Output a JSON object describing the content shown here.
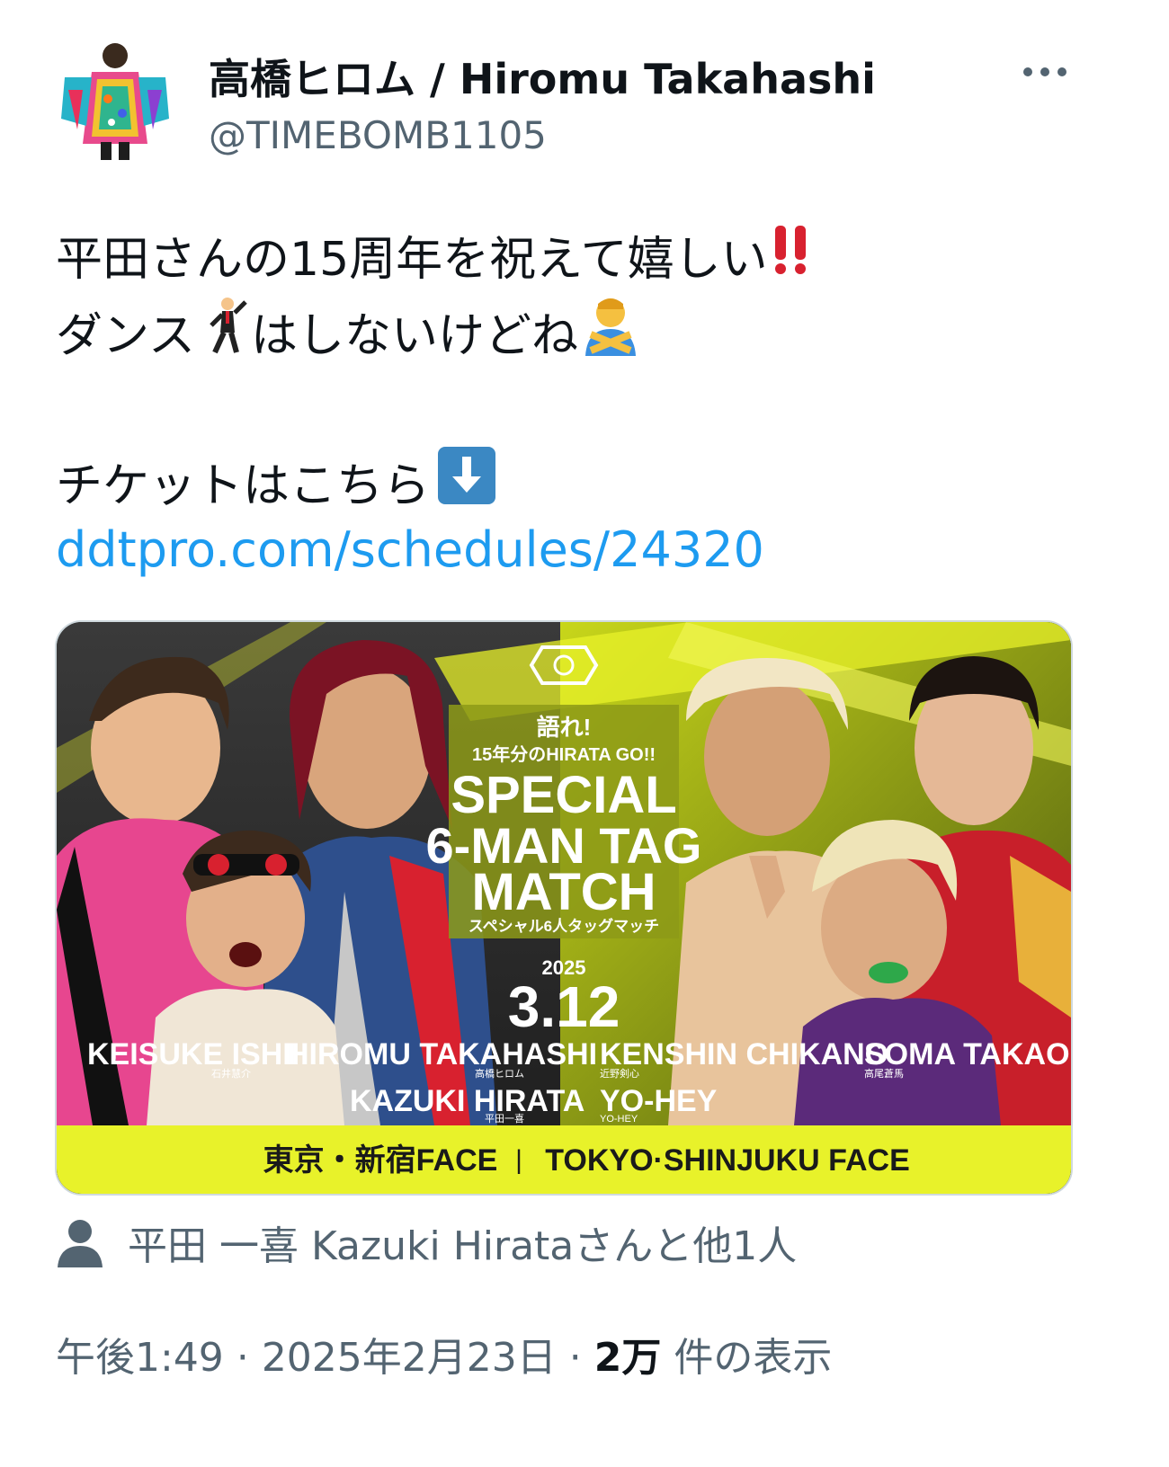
{
  "header": {
    "display_name": "高橋ヒロム / Hiromu Takahashi",
    "handle": "@TIMEBOMB1105",
    "more_icon": "more-horizontal-icon"
  },
  "body": {
    "line1": "平田さんの15周年を祝えて嬉しい",
    "line1_emoji": "double-exclamation-icon",
    "line2_a": "ダンス",
    "line2_emoji_a": "man-dancing-icon",
    "line2_b": "はしないけどね",
    "line2_emoji_b": "person-gesturing-no-icon",
    "line3": "チケットはこちら",
    "line3_emoji": "down-arrow-icon",
    "link": "ddtpro.com/schedules/24320"
  },
  "poster": {
    "header_line1": "語れ!",
    "header_line2": "15年分のHIRATA GO!!",
    "title_line1": "SPECIAL",
    "title_line2": "6-MAN TAG",
    "title_line3": "MATCH",
    "subtitle": "スペシャル6人タッグマッチ",
    "year": "2025",
    "date": "3.12",
    "wrestlers": [
      {
        "name": "KEISUKE ISHII",
        "kana": "石井慧介"
      },
      {
        "name": "HIROMU TAKAHASHI",
        "kana": "高橋ヒロム"
      },
      {
        "name": "KAZUKI HIRATA",
        "kana": "平田一喜"
      },
      {
        "name": "KENSHIN CHIKANO",
        "kana": "近野剣心"
      },
      {
        "name": "YO-HEY",
        "kana": "YO-HEY"
      },
      {
        "name": "SOMA TAKAO",
        "kana": "高尾蒼馬"
      }
    ],
    "venue_jp": "東京・新宿FACE",
    "separator": "|",
    "venue_en": "TOKYO·SHINJUKU FACE",
    "accent_color": "#e8f22a"
  },
  "tagged": {
    "icon": "person-icon",
    "text": "平田 一喜 Kazuki Hirataさんと他1人"
  },
  "meta": {
    "time": "午後1:49",
    "sep1": "·",
    "date": "2025年2月23日",
    "sep2": "·",
    "views_count": "2万",
    "views_label": "件の表示"
  }
}
